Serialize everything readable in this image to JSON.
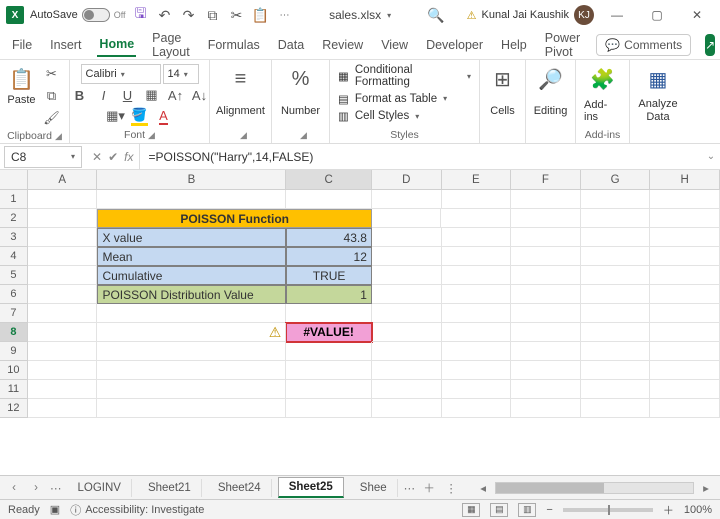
{
  "titlebar": {
    "autosave_label": "AutoSave",
    "autosave_state": "Off",
    "filename": "sales.xlsx",
    "filename_dropdown": "▾",
    "search_icon": "🔍",
    "warn_icon": "⚠",
    "user_name": "Kunal Jai Kaushik",
    "user_initials": "KJ",
    "min": "—",
    "max": "▢",
    "close": "✕"
  },
  "menu": {
    "file": "File",
    "insert": "Insert",
    "home": "Home",
    "page_layout": "Page Layout",
    "formulas": "Formulas",
    "data": "Data",
    "review": "Review",
    "view": "View",
    "developer": "Developer",
    "help": "Help",
    "power_pivot": "Power Pivot",
    "comments": "Comments"
  },
  "ribbon": {
    "clipboard": {
      "label": "Clipboard",
      "paste": "Paste"
    },
    "font": {
      "label": "Font",
      "name": "Calibri",
      "size": "14",
      "bold": "B",
      "italic": "I",
      "underline": "U"
    },
    "alignment": {
      "label": "Alignment"
    },
    "number": {
      "label": "Number",
      "pct": "%"
    },
    "styles": {
      "label": "Styles",
      "cf": "Conditional Formatting",
      "fat": "Format as Table",
      "cs": "Cell Styles"
    },
    "cells": {
      "label": "Cells"
    },
    "editing": {
      "label": "Editing"
    },
    "addins": {
      "label": "Add-ins",
      "btn": "Add-ins"
    },
    "analyze": {
      "label": "Analyze Data",
      "btn1": "Analyze",
      "btn2": "Data"
    }
  },
  "refbar": {
    "name": "C8",
    "formula": "=POISSON(\"Harry\",14,FALSE)"
  },
  "columns": [
    "A",
    "B",
    "C",
    "D",
    "E",
    "F",
    "G",
    "H"
  ],
  "rownums": [
    "1",
    "2",
    "3",
    "4",
    "5",
    "6",
    "7",
    "8",
    "9",
    "10",
    "11",
    "12"
  ],
  "sheet": {
    "title": "POISSON Function",
    "r3b": "X value",
    "r3c": "43.8",
    "r4b": "Mean",
    "r4c": "12",
    "r5b": "Cumulative",
    "r5c": "TRUE",
    "r6b": "POISSON Distribution Value",
    "r6c": "1",
    "err": "#VALUE!",
    "warn": "⚠"
  },
  "tabs": {
    "loginv": "LOGINV",
    "s21": "Sheet21",
    "s24": "Sheet24",
    "s25": "Sheet25",
    "shee": "Shee"
  },
  "status": {
    "ready": "Ready",
    "acc": "Accessibility: Investigate",
    "zoom": "100%"
  }
}
